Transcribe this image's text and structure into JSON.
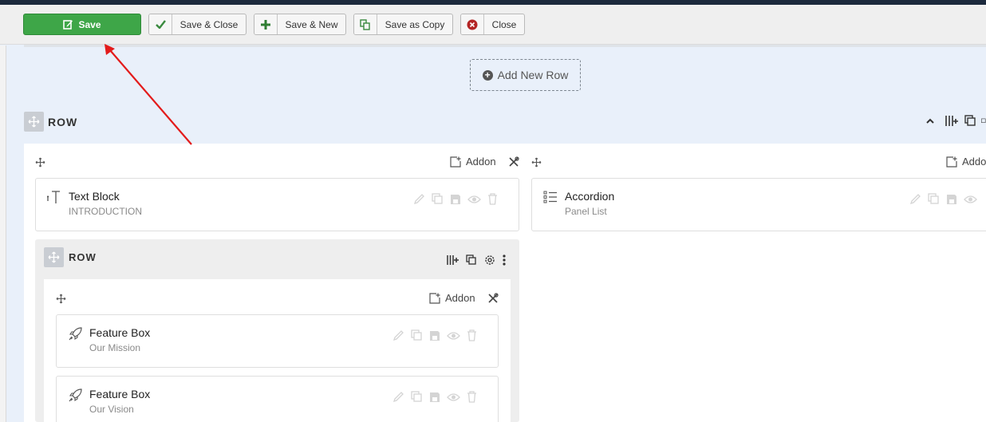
{
  "toolbar": {
    "save": "Save",
    "save_close": "Save & Close",
    "save_new": "Save & New",
    "save_copy": "Save as Copy",
    "close": "Close"
  },
  "add_row_label": "Add New Row",
  "outer_row": {
    "title": "ROW"
  },
  "columns": [
    {
      "addon_label": "Addon",
      "addon": {
        "title": "Text Block",
        "subtitle": "INTRODUCTION",
        "icon": "text-icon"
      }
    },
    {
      "addon_label": "Addon",
      "addon": {
        "title": "Accordion",
        "subtitle": "Panel List",
        "icon": "list-icon"
      }
    }
  ],
  "inner_row": {
    "title": "ROW",
    "addon_label": "Addon",
    "addons": [
      {
        "title": "Feature Box",
        "subtitle": "Our Mission",
        "icon": "rocket-icon"
      },
      {
        "title": "Feature Box",
        "subtitle": "Our Vision",
        "icon": "rocket-icon"
      }
    ]
  },
  "colors": {
    "save_green": "#3ea648",
    "annotation_arrow": "#e31b1b"
  }
}
